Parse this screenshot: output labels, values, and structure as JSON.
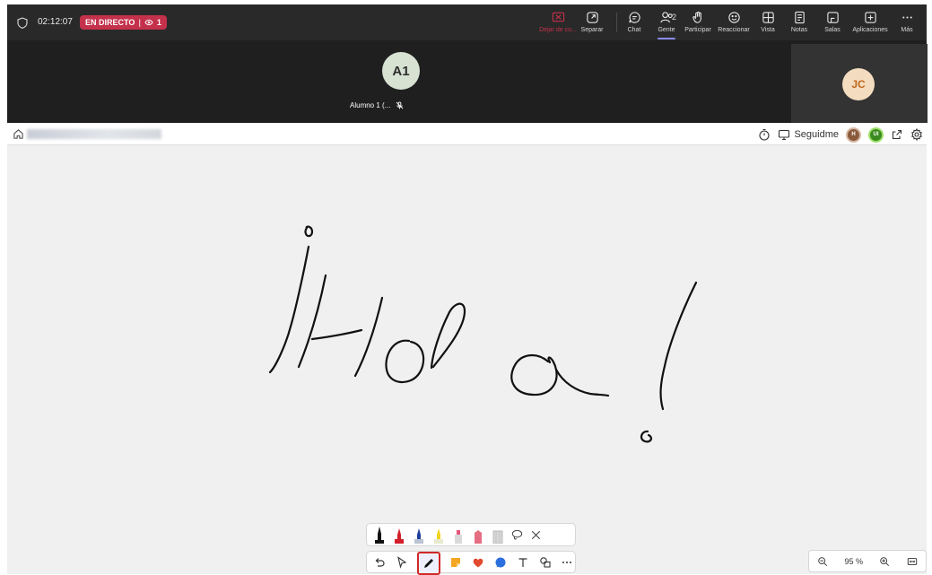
{
  "header": {
    "timer": "02:12:07",
    "live_label": "EN DIRECTO",
    "live_viewers": "1",
    "buttons": {
      "stop_share": "Dejar de co...",
      "separate": "Separar",
      "chat": "Chat",
      "people": "Gente",
      "people_count": "2",
      "raise_hand": "Participar",
      "react": "Reaccionar",
      "view": "Vista",
      "notes": "Notas",
      "rooms": "Salas",
      "apps": "Aplicaciones",
      "more": "Más"
    },
    "colors": {
      "live": "#c4314b",
      "active_underline": "#8b8bf0"
    }
  },
  "participants": {
    "main": {
      "initials": "A1",
      "name": "Alumno 1 (..."
    },
    "side": {
      "initials": "JC"
    }
  },
  "whiteboard": {
    "follow_label": "Seguidme",
    "follower_initials": [
      "H",
      "UI"
    ],
    "zoom_label": "95 %",
    "ink_color": "#111111"
  },
  "toolbar": {
    "pens": [
      "black",
      "red",
      "blue",
      "yellow",
      "pink-marker",
      "red-highlighter",
      "eraser"
    ],
    "selected_tool": "pen"
  }
}
